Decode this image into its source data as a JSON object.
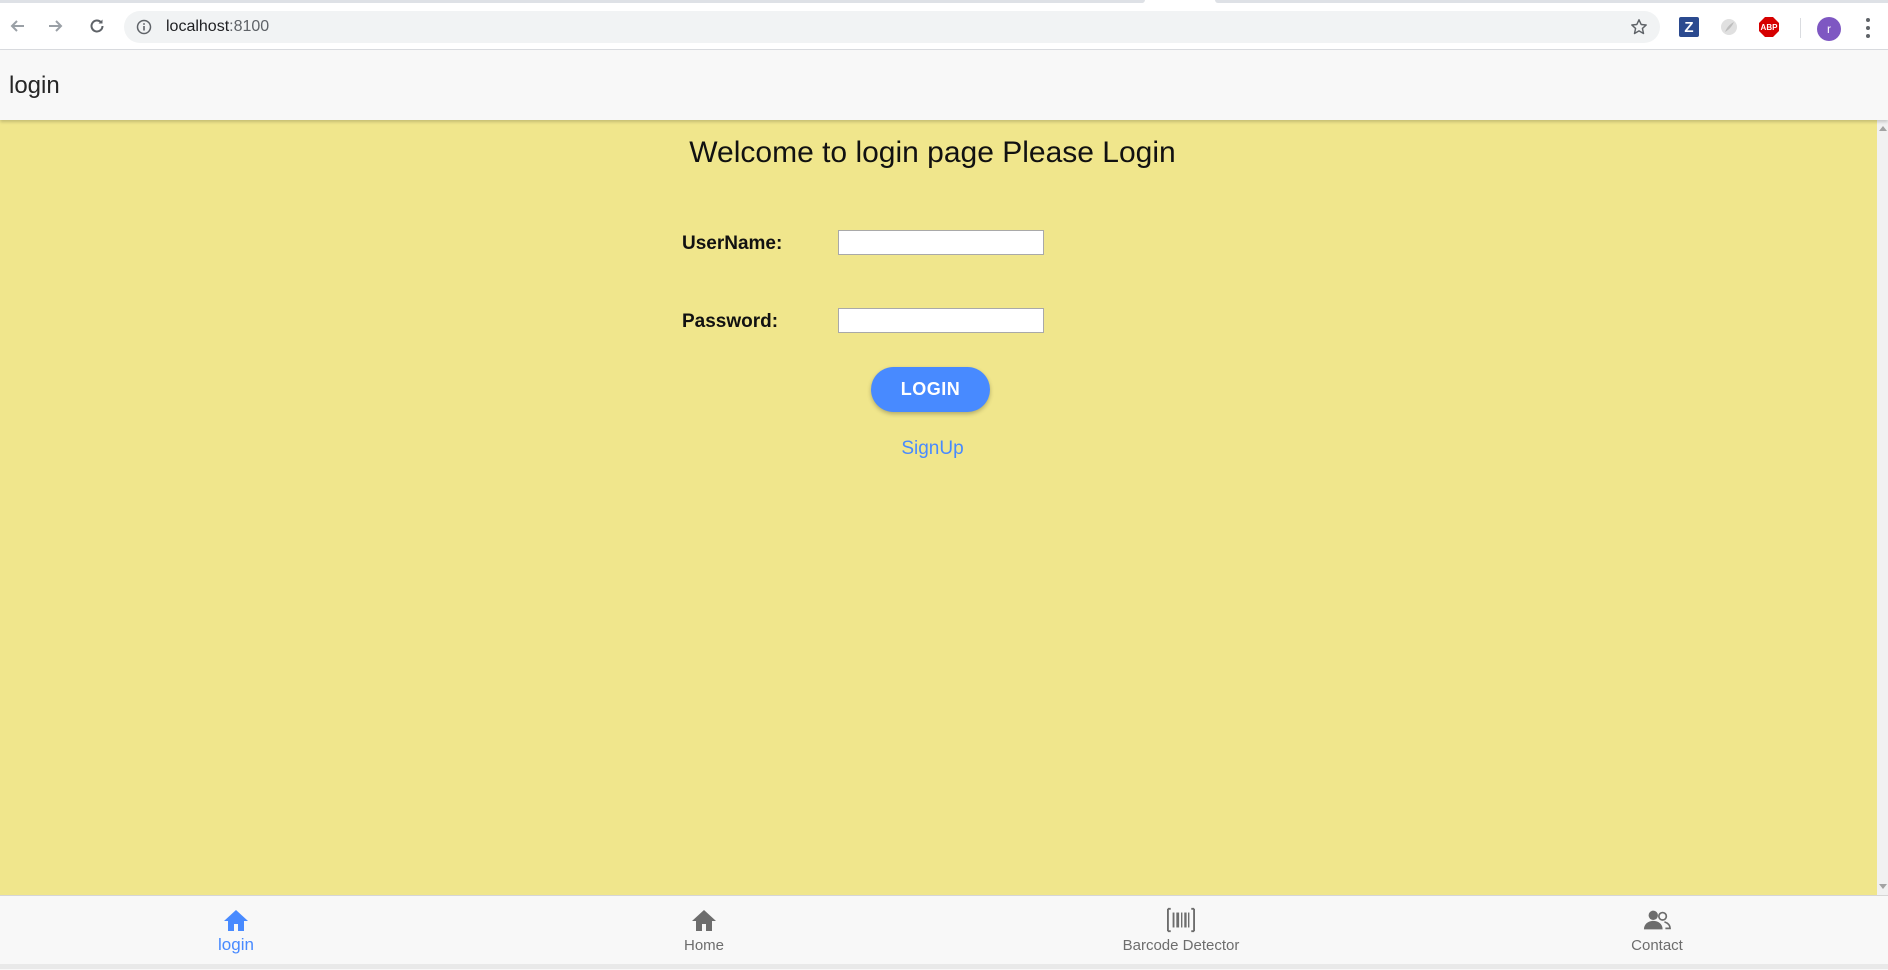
{
  "browser": {
    "url_host": "localhost",
    "url_port": ":8100",
    "ext_z_label": "Z",
    "ext_abp_label": "ABP",
    "avatar_initial": "r"
  },
  "header": {
    "title": "login"
  },
  "login_form": {
    "welcome": "Welcome to login page Please Login",
    "username_label": "UserName:",
    "username_value": "",
    "password_label": "Password:",
    "password_value": "",
    "login_button": "LOGIN",
    "signup_link": "SignUp"
  },
  "tabs": [
    {
      "label": "login",
      "icon": "home-icon",
      "active": true
    },
    {
      "label": "Home",
      "icon": "home-icon",
      "active": false
    },
    {
      "label": "Barcode Detector",
      "icon": "barcode-icon",
      "active": false
    },
    {
      "label": "Contact",
      "icon": "contacts-icon",
      "active": false
    }
  ],
  "colors": {
    "content_bg": "#f0e68c",
    "accent": "#488aff",
    "header_bg": "#f8f8f8",
    "tab_inactive": "#6d6d6d"
  }
}
